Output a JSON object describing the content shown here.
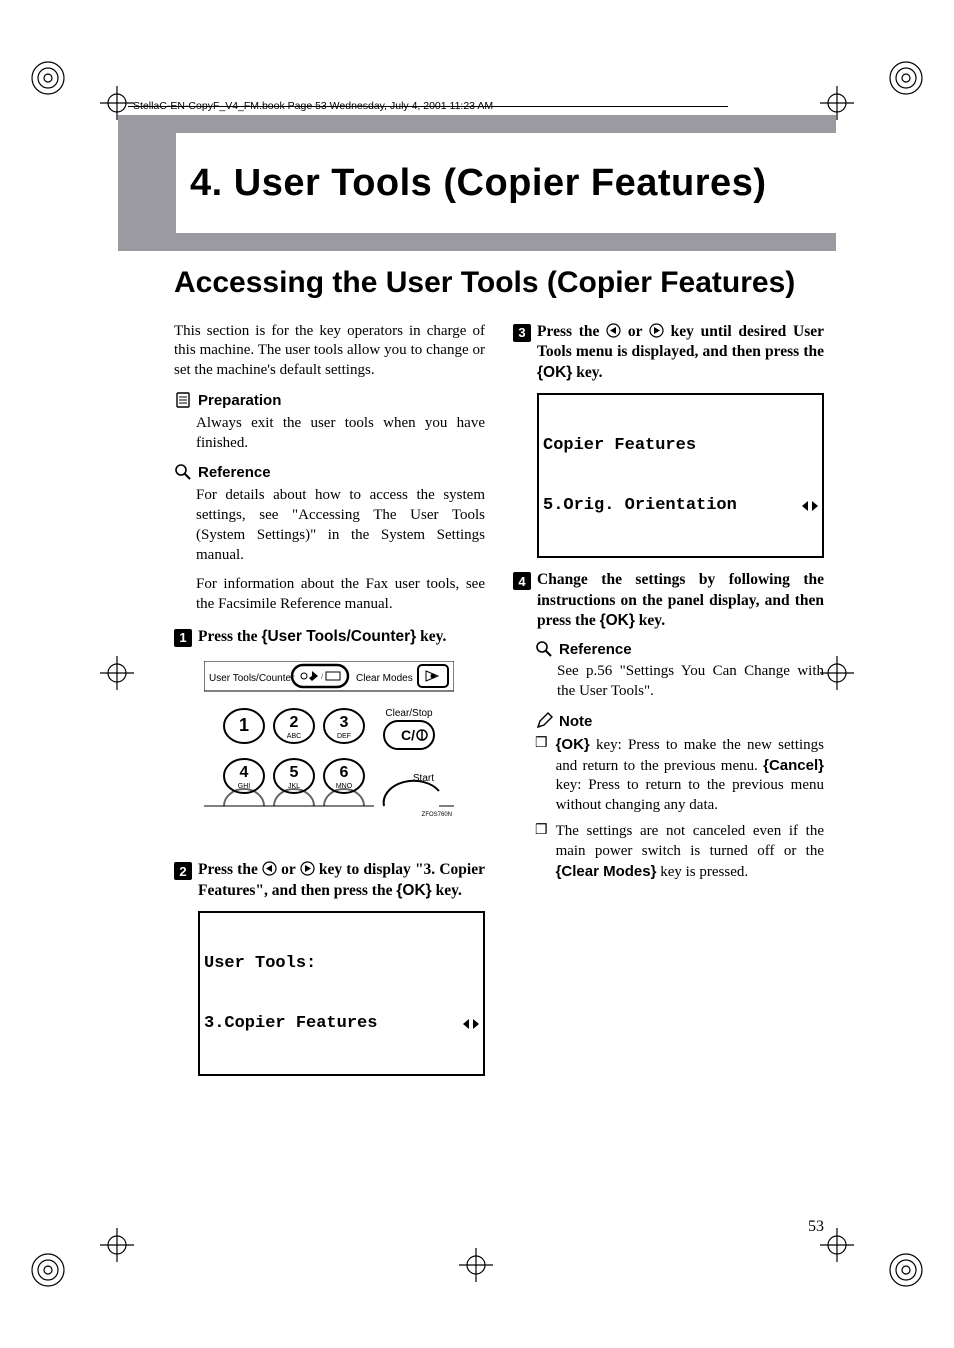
{
  "runhead": "StellaC-EN-CopyF_V4_FM.book  Page 53  Wednesday, July 4, 2001  11:23 AM",
  "chapter_title": "4. User Tools (Copier Features)",
  "section_title": "Accessing the User Tools (Copier Features)",
  "intro": "This section is for the key operators in charge of this machine. The user tools allow you to change or set the machine's default settings.",
  "labels": {
    "preparation": "Preparation",
    "reference": "Reference",
    "note": "Note"
  },
  "preparation_text": "Always exit the user tools when you have finished.",
  "reference1_p1": "For details about how to access the system settings, see \"Accessing The User Tools (System Settings)\" in the System Settings manual.",
  "reference1_p2": "For information about the Fax user tools, see the Facsimile Reference manual.",
  "keys": {
    "user_tools_counter": "User Tools/Counter",
    "ok": "OK",
    "cancel": "Cancel",
    "clear_modes": "Clear Modes"
  },
  "steps": {
    "s1": {
      "pre": "Press the ",
      "post": " key."
    },
    "s2": {
      "pre": "Press the ",
      "mid": " or ",
      "post": " key to display \"3. Copier Features\", and then press the ",
      "tail": " key."
    },
    "s3": {
      "pre": "Press the ",
      "mid": " or ",
      "post": " key until desired User Tools menu is displayed, and then press the ",
      "tail": " key."
    },
    "s4": {
      "text": "Change the settings by following the instructions on the panel display, and then press the ",
      "tail": " key."
    }
  },
  "lcd1": {
    "line1": "User Tools:",
    "line2": "3.Copier Features"
  },
  "lcd2": {
    "line1": "Copier Features",
    "line2": "5.Orig. Orientation"
  },
  "reference2": "See p.56 \"Settings You Can Change with the User Tools\".",
  "note1": {
    "pre": "",
    "k1": "OK",
    "mid1": " key: Press to make the new settings and return to the previous menu. ",
    "k2": "Cancel",
    "mid2": " key: Press to return to the previous menu without changing any data."
  },
  "note2": {
    "pre": "The settings are not canceled even if the main power switch is turned off or the ",
    "k": "Clear Modes",
    "post": " key is pressed."
  },
  "keypad": {
    "header_left": "User Tools/Counter",
    "header_right": "Clear Modes",
    "clear_stop": "Clear/Stop",
    "start": "Start",
    "figref": "ZFOS760N",
    "keys": [
      {
        "num": "1",
        "sub": ""
      },
      {
        "num": "2",
        "sub": "ABC"
      },
      {
        "num": "3",
        "sub": "DEF"
      },
      {
        "num": "4",
        "sub": "GHI"
      },
      {
        "num": "5",
        "sub": "JKL"
      },
      {
        "num": "6",
        "sub": "MNO"
      }
    ]
  },
  "page_number": "53"
}
